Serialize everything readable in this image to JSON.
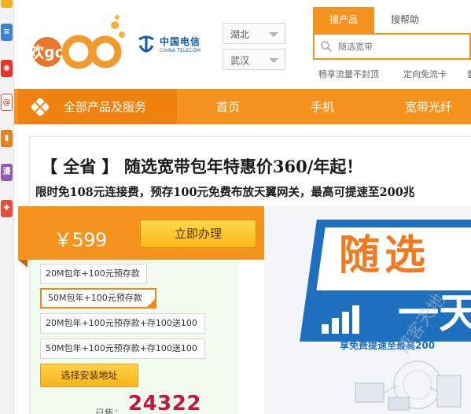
{
  "sidebar_icons": [
    {
      "icon": "gold-tile-icon",
      "color": "#f0b323"
    },
    {
      "icon": "list-icon",
      "color": "#3d7fd6"
    },
    {
      "icon": "weibo-icon",
      "color": "#e8332a"
    },
    {
      "icon": "at-sign-icon",
      "color": "#e84c3d"
    },
    {
      "icon": "bookmark-icon",
      "color": "#e67e22"
    },
    {
      "icon": "comic-icon",
      "color": "#9b59b6"
    },
    {
      "icon": "game-controller-icon",
      "color": "#e74c3c"
    }
  ],
  "header": {
    "logo_text": "欢go",
    "brand_cn": "中国电信",
    "brand_en": "CHINA TELECOM",
    "province": "湖北",
    "city": "武汉",
    "search_tabs": [
      "搜产品",
      "搜帮助"
    ],
    "search_placeholder": "随选宽带",
    "hot_links": [
      "畅享流量不封顶",
      "定向免流卡",
      "套"
    ]
  },
  "nav": {
    "all_products": "全部产品及服务",
    "items": [
      "首页",
      "手机",
      "宽带光纤"
    ]
  },
  "promo": {
    "title": "【 全省 】 随选宽带包年特惠价360/年起！",
    "subtitle": "限时免108元连接费，预存100元免费布放天翼网关，最高可提速至200兆",
    "price": "￥599",
    "buy_button": "立即办理",
    "options": [
      "20M包年+100元预存款",
      "50M包年+100元预存款",
      "20M包年+100元预存款+存100送100",
      "50M包年+100元预存款+存100送100"
    ],
    "selected_option": 1,
    "address_button": "选择安装地址",
    "sold_label": "已售：",
    "sold_count": "24322"
  },
  "banner": {
    "headline_1": "随选",
    "headline_2": "一天",
    "subline": "享免费提速至最高200",
    "watermark": "博客天地"
  },
  "colors": {
    "brand_orange": "#f6921e",
    "nav_dark_orange": "#f0820f",
    "telecom_blue": "#0d5aa7",
    "banner_blue": "#1e6fbd",
    "sold_red": "#c1183d"
  }
}
